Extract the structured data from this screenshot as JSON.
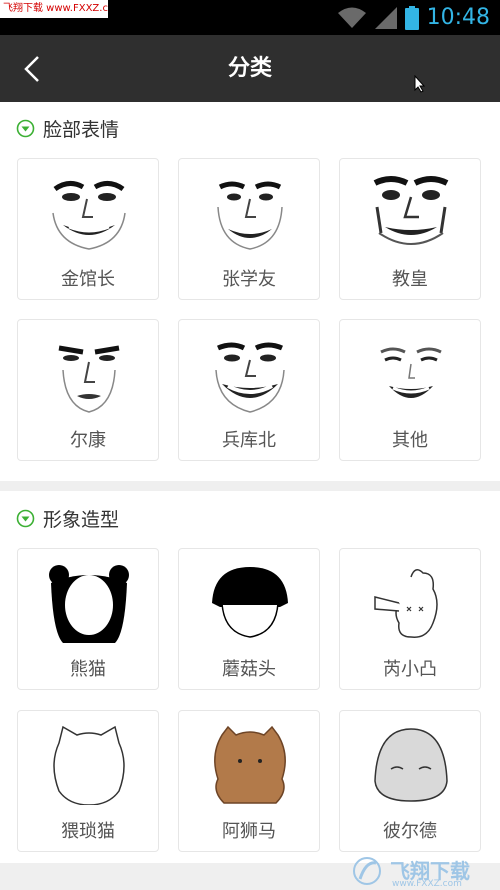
{
  "status": {
    "watermark": "飞翔下载 www.FXXZ.com",
    "time": "10:48"
  },
  "header": {
    "title": "分类"
  },
  "sections": [
    {
      "title": "脸部表情",
      "items": [
        {
          "label": "金馆长"
        },
        {
          "label": "张学友"
        },
        {
          "label": "教皇"
        },
        {
          "label": "尔康"
        },
        {
          "label": "兵库北"
        },
        {
          "label": "其他"
        }
      ]
    },
    {
      "title": "形象造型",
      "items": [
        {
          "label": "熊猫"
        },
        {
          "label": "蘑菇头"
        },
        {
          "label": "芮小凸"
        },
        {
          "label": "猥琐猫"
        },
        {
          "label": "阿狮马"
        },
        {
          "label": "彼尔德"
        }
      ]
    }
  ],
  "footer_watermark": {
    "brand": "飞翔下载",
    "url": "www.FXXZ.com"
  },
  "colors": {
    "accent": "#3cb034",
    "header": "#2f2f2f",
    "time": "#33b5e5"
  }
}
